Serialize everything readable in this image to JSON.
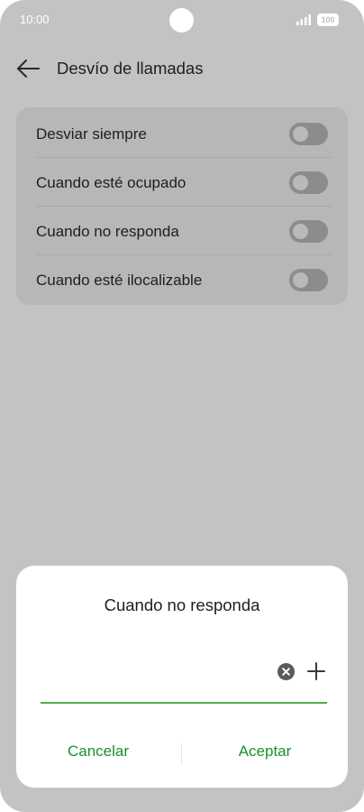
{
  "status_bar": {
    "time": "10:00",
    "battery": "100",
    "icons": [
      "signal-icon",
      "battery-icon"
    ]
  },
  "header": {
    "back_icon": "arrow-left-icon",
    "title": "Desvío de llamadas"
  },
  "settings": {
    "items": [
      {
        "label": "Desviar siempre",
        "enabled": false
      },
      {
        "label": "Cuando esté ocupado",
        "enabled": false
      },
      {
        "label": "Cuando no responda",
        "enabled": false
      },
      {
        "label": "Cuando esté ilocalizable",
        "enabled": false
      }
    ]
  },
  "dialog": {
    "title": "Cuando no responda",
    "input_value": "",
    "clear_icon": "clear-circle-icon",
    "add_icon": "plus-icon",
    "cancel_label": "Cancelar",
    "accept_label": "Aceptar"
  },
  "colors": {
    "background": "#c3c3c5",
    "card": "#b7b7b9",
    "accent": "#1a8f2e",
    "input_underline": "#4caf50"
  }
}
